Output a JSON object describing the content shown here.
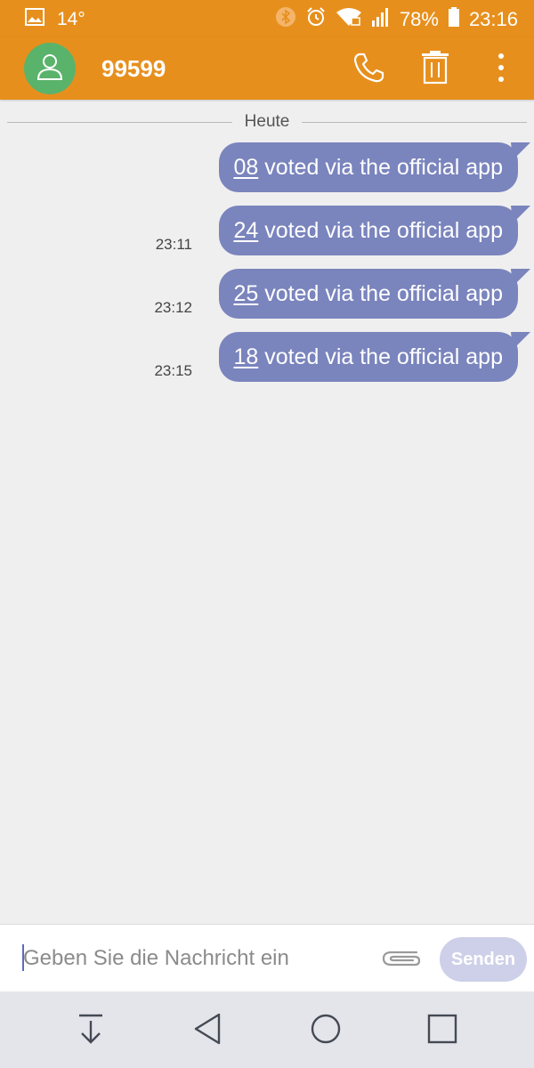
{
  "status_bar": {
    "temperature": "14°",
    "battery": "78%",
    "time": "23:16",
    "icons": [
      "gallery-icon",
      "bluetooth-icon",
      "alarm-icon",
      "wifi-icon",
      "signal-icon",
      "battery-icon"
    ]
  },
  "header": {
    "contact": "99599",
    "actions": [
      "phone-icon",
      "delete-icon",
      "more-options-icon"
    ]
  },
  "conversation": {
    "date_label": "Heute",
    "messages": [
      {
        "number": "08",
        "text": " voted via the official app",
        "time": ""
      },
      {
        "number": "24",
        "text": " voted via the official app",
        "time": "23:11"
      },
      {
        "number": "25",
        "text": " voted via the official app",
        "time": "23:12"
      },
      {
        "number": "18",
        "text": " voted via the official app",
        "time": "23:15"
      }
    ]
  },
  "compose": {
    "placeholder": "Geben Sie die Nachricht ein",
    "send_label": "Senden"
  },
  "colors": {
    "accent": "#e78f1d",
    "bubble": "#7a84bd",
    "avatar": "#5ab36a",
    "background": "#efefef",
    "send_disabled": "#cdd0e8"
  }
}
